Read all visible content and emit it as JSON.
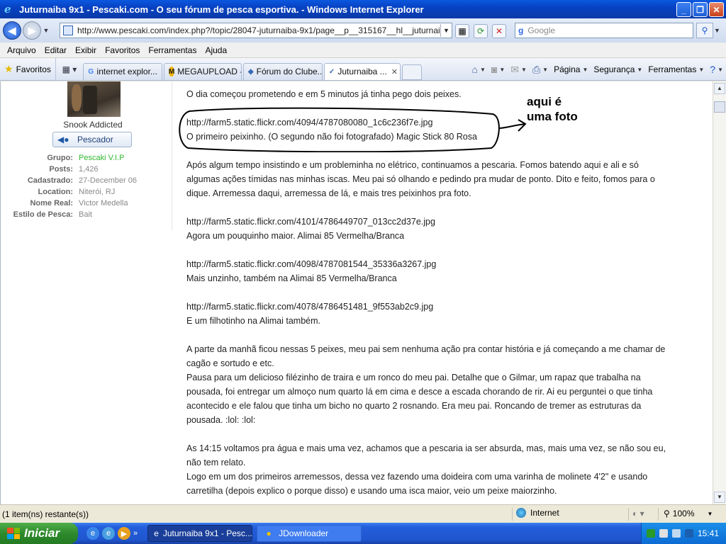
{
  "window": {
    "title": "Juturnaiba 9x1 - Pescaki.com - O seu fórum de pesca esportiva. - Windows Internet Explorer",
    "minimize": "_",
    "maximize": "❐",
    "close": "✕"
  },
  "address": {
    "url": "http://www.pescaki.com/index.php?/topic/28047-juturnaiba-9x1/page__p__315167__hl__juturnaiba__frc",
    "search_placeholder": "Google",
    "search_brand": "g"
  },
  "menu": [
    "Arquivo",
    "Editar",
    "Exibir",
    "Favoritos",
    "Ferramentas",
    "Ajuda"
  ],
  "favorites_label": "Favoritos",
  "tabs": [
    {
      "label": "internet explor...",
      "icon": "G",
      "active": false
    },
    {
      "label": "MEGAUPLOAD -...",
      "icon": "M",
      "active": false
    },
    {
      "label": "Fórum do Clube...",
      "icon": "◆",
      "active": false
    },
    {
      "label": "Juturnaiba ...",
      "icon": "✓",
      "active": true
    }
  ],
  "command_bar": [
    "Página",
    "Segurança",
    "Ferramentas"
  ],
  "profile": {
    "user_title": "Snook Addicted",
    "rank": "Pescador",
    "fields": [
      {
        "label": "Grupo:",
        "value": "Pescaki V.I.P"
      },
      {
        "label": "Posts:",
        "value": "1,426"
      },
      {
        "label": "Cadastrado:",
        "value": "27-December 06"
      },
      {
        "label": "Location:",
        "value": "Niterói, RJ"
      },
      {
        "label": "Nome Real:",
        "value": "Victor Medella"
      },
      {
        "label": "Estilo de Pesca:",
        "value": "Bait"
      }
    ]
  },
  "post": {
    "p1": [
      "O dia começou prometendo e em 5 minutos já tinha pego dois peixes."
    ],
    "p2": [
      "http://farm5.static.flickr.com/4094/4787080080_1c6c236f7e.jpg",
      "O primeiro peixinho. (O segundo não foi fotografado) Magic Stick 80 Rosa"
    ],
    "p3": [
      "Após algum tempo insistindo e um probleminha no elétrico, continuamos a pescaria. Fomos batendo aqui e ali e só",
      "algumas ações tímidas nas minhas iscas. Meu pai só olhando e pedindo pra mudar de ponto. Dito e feito, fomos para o",
      "dique. Arremessa daqui, arremessa de lá, e mais tres peixinhos pra foto."
    ],
    "p4": [
      "http://farm5.static.flickr.com/4101/4786449707_013cc2d37e.jpg",
      "Agora um pouquinho maior. Alimai 85 Vermelha/Branca"
    ],
    "p5": [
      "http://farm5.static.flickr.com/4098/4787081544_35336a3267.jpg",
      "Mais unzinho, também na Alimai 85 Vermelha/Branca"
    ],
    "p6": [
      "http://farm5.static.flickr.com/4078/4786451481_9f553ab2c9.jpg",
      "E um filhotinho na Alimai também."
    ],
    "p7": [
      "A parte da manhã ficou nessas 5 peixes, meu pai sem nenhuma ação pra contar história e já começando a me chamar de",
      "cagão e sortudo e etc.",
      "Pausa para um delicioso filézinho de traira e um ronco do meu pai. Detalhe que o Gilmar, um rapaz que trabalha na",
      "pousada, foi entregar um almoço num quarto lá em cima e desce a escada chorando de rir. Ai eu perguntei o que tinha",
      "acontecido e ele falou que tinha um bicho no quarto 2 rosnando. Era meu pai. Roncando de tremer as estruturas da",
      "pousada. :lol: :lol:"
    ],
    "p8": [
      "As 14:15 voltamos pra água e mais uma vez, achamos que a pescaria ia ser absurda, mas, mais uma vez, se não sou eu,",
      "não tem relato.",
      "Logo em um dos primeiros arremessos, dessa vez fazendo uma doideira com uma varinha de molinete 4'2\" e usando",
      "carretilha (depois explico o porque disso) e usando uma isca maior, veio um peixe maiorzinho."
    ]
  },
  "annotation": {
    "line1": "aqui é",
    "line2": "uma foto"
  },
  "status": {
    "text": "(1 item(ns) restante(s))",
    "zone": "Internet",
    "zoom": "100%"
  },
  "taskbar": {
    "start": "Iniciar",
    "items": [
      {
        "label": "Juturnaiba 9x1 - Pesc...",
        "active": true
      },
      {
        "label": "JDownloader",
        "active": false
      }
    ],
    "clock": "15:41"
  }
}
